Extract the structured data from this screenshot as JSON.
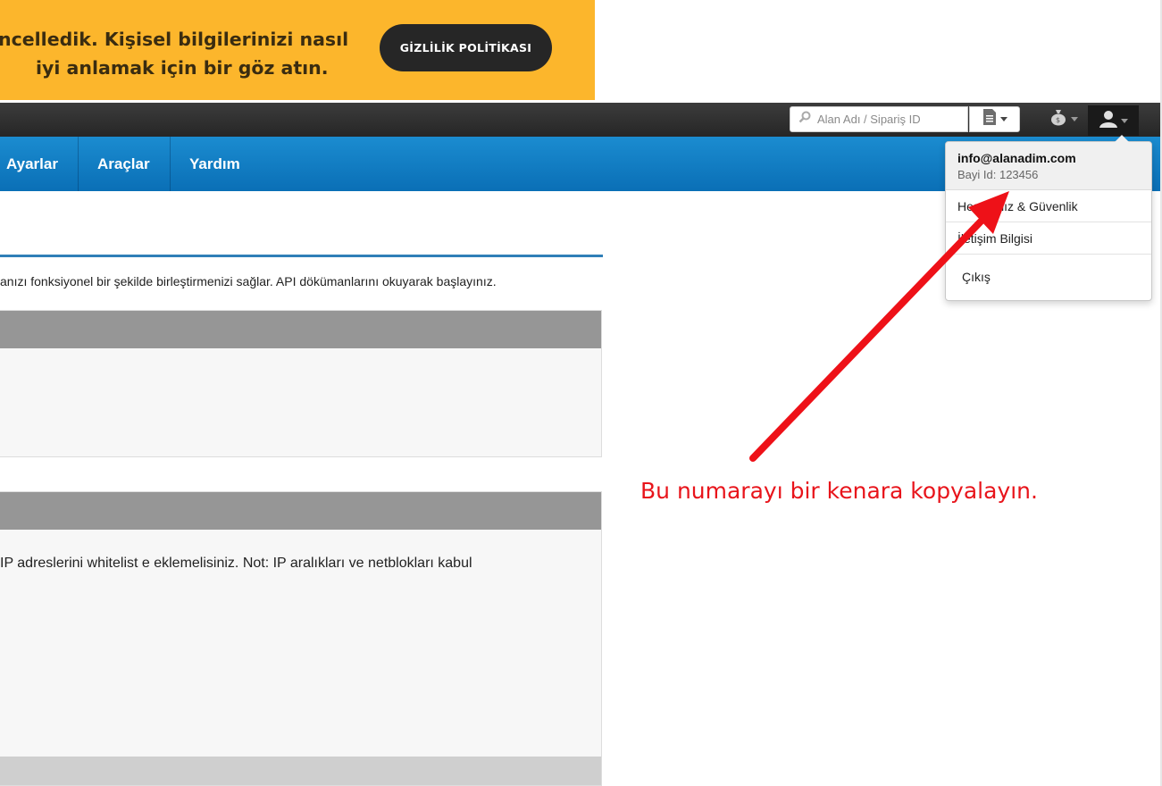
{
  "banner": {
    "line1": "ncelledik. Kişisel bilgilerinizi nasıl",
    "line2": "iyi anlamak için bir göz atın.",
    "button_label": "GİZLİLİK POLİTİKASI"
  },
  "topbar": {
    "search_placeholder": "Alan Adı / Sipariş ID",
    "icons": [
      "search-icon",
      "document-icon",
      "money-bag-icon",
      "user-icon"
    ]
  },
  "nav": {
    "items": [
      {
        "label": "Ayarlar"
      },
      {
        "label": "Araçlar"
      },
      {
        "label": "Yardım"
      }
    ]
  },
  "content": {
    "intro": "anızı fonksiyonel bir şekilde birleştirmenizi sağlar. API dökümanlarını okuyarak başlayınız.",
    "panel2_text": "IP adreslerini whitelist e eklemelisiniz. Not: IP aralıkları ve netblokları kabul"
  },
  "user_menu": {
    "email": "info@alanadim.com",
    "bayi_id": "Bayi Id: 123456",
    "items": [
      {
        "label": "Hesabınız & Güvenlik"
      },
      {
        "label": "İletişim Bilgisi"
      },
      {
        "label": "Çıkış"
      }
    ]
  },
  "annotation": {
    "text": "Bu numarayı bir kenara kopyalayın.",
    "color": "#e8141b"
  },
  "colors": {
    "banner": "#fcb62c",
    "nav": "#1080c8",
    "topbar": "#2e2e2e",
    "panel_header": "#969696"
  }
}
